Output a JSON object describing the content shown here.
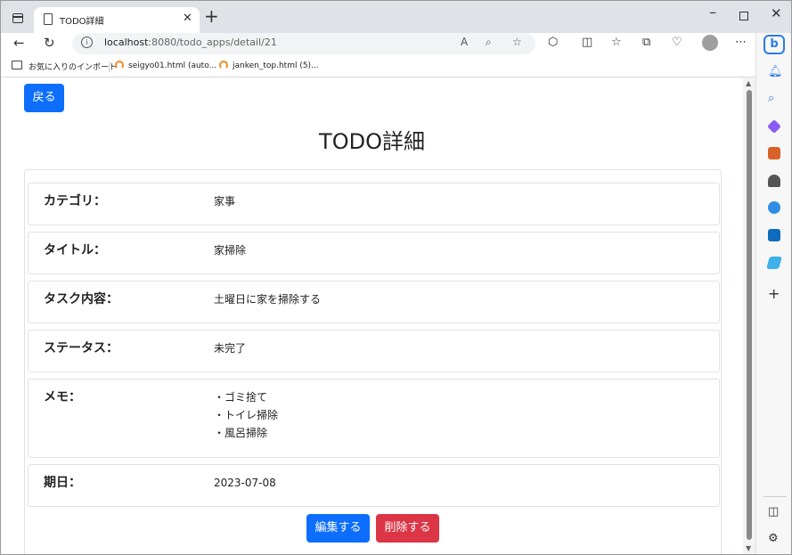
{
  "browser": {
    "tab_title": "TODO詳細",
    "tab_close": "✕",
    "new_tab": "+",
    "url_host": "localhost",
    "url_path": ":8080/todo_apps/detail/21",
    "bookmarks": [
      {
        "label": "お気に入りのインポート",
        "icon": "folder-icon"
      },
      {
        "label": "seigyo01.html (auto...",
        "icon": "ring-icon"
      },
      {
        "label": "janken_top.html (5)...",
        "icon": "ring-icon"
      }
    ]
  },
  "page": {
    "back_button": "戻る",
    "title": "TODO詳細",
    "fields": [
      {
        "label": "カテゴリ：",
        "value": "家事"
      },
      {
        "label": "タイトル：",
        "value": "家掃除"
      },
      {
        "label": "タスク内容：",
        "value": "土曜日に家を掃除する"
      },
      {
        "label": "ステータス：",
        "value": "未完了"
      },
      {
        "label": "メモ：",
        "lines": [
          "・ゴミ捨て",
          "・トイレ掃除",
          "・風呂掃除"
        ]
      },
      {
        "label": "期日：",
        "value": "2023-07-08"
      }
    ],
    "edit_button": "編集する",
    "delete_button": "削除する"
  },
  "colors": {
    "primary": "#0d6efd",
    "danger": "#dc3545"
  }
}
